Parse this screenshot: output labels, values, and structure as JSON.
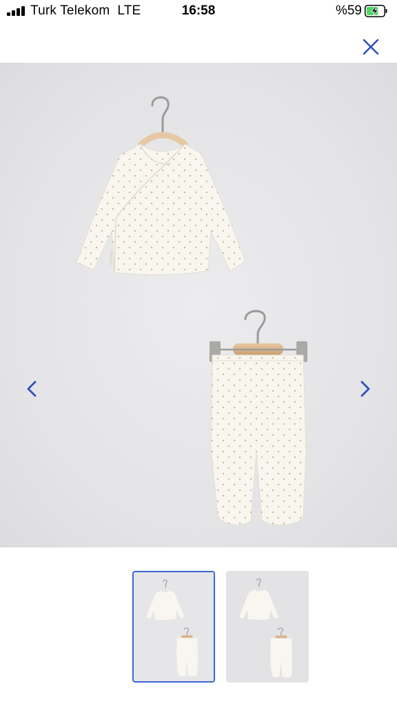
{
  "status_bar": {
    "carrier": "Turk Telekom",
    "network": "LTE",
    "time": "16:58",
    "battery_percent": "%59"
  },
  "colors": {
    "accent": "#2d4fc0",
    "thumb_selected_border": "#3a64d8",
    "battery_fill": "#4cd964"
  },
  "icons": {
    "close": "close-icon",
    "prev": "chevron-left-icon",
    "next": "chevron-right-icon"
  },
  "gallery": {
    "image_count": 2,
    "selected_index": 0
  }
}
